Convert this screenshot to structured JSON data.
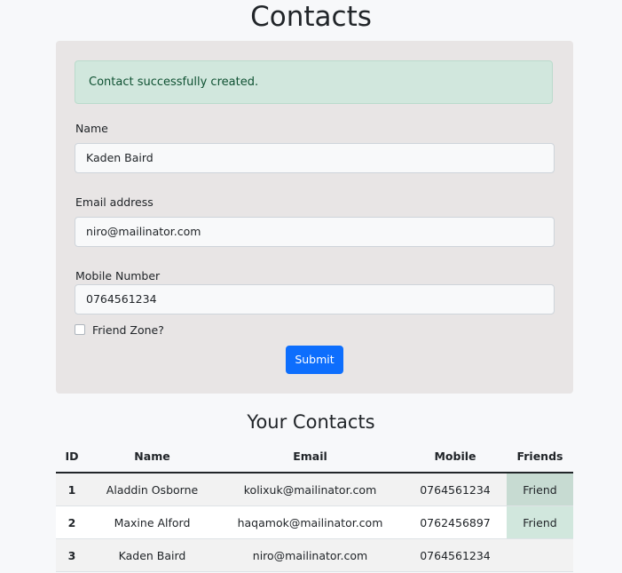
{
  "page": {
    "title": "Contacts"
  },
  "alert": {
    "message": "Contact successfully created."
  },
  "form": {
    "name_label": "Name",
    "name_value": "Kaden Baird",
    "email_label": "Email address",
    "email_value": "niro@mailinator.com",
    "mobile_label": "Mobile Number",
    "mobile_value": "0764561234",
    "friend_zone_label": "Friend Zone?",
    "friend_zone_checked": false,
    "submit_label": "Submit"
  },
  "contacts": {
    "title": "Your Contacts",
    "headers": {
      "id": "ID",
      "name": "Name",
      "email": "Email",
      "mobile": "Mobile",
      "friends": "Friends"
    },
    "rows": [
      {
        "id": "1",
        "name": "Aladdin Osborne",
        "email": "kolixuk@mailinator.com",
        "mobile": "0764561234",
        "friend": "Friend"
      },
      {
        "id": "2",
        "name": "Maxine Alford",
        "email": "haqamok@mailinator.com",
        "mobile": "0762456897",
        "friend": "Friend"
      },
      {
        "id": "3",
        "name": "Kaden Baird",
        "email": "niro@mailinator.com",
        "mobile": "0764561234",
        "friend": ""
      }
    ]
  },
  "colors": {
    "primary": "#0d6efd",
    "success_bg": "#d1e7dd",
    "card_bg": "#e8e5e5"
  }
}
